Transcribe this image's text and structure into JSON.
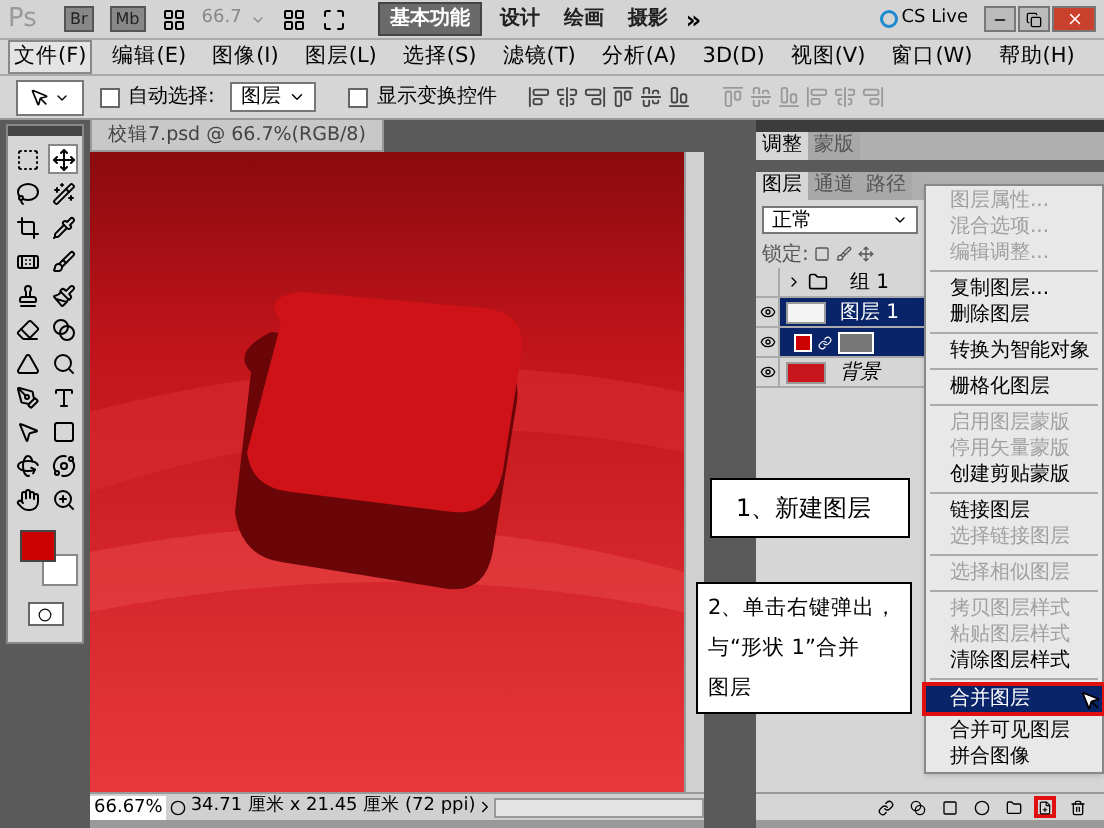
{
  "title_bar": {
    "logo": "Ps",
    "apps": [
      "Br",
      "Mb"
    ],
    "zoom": "66.7",
    "workspaces": [
      {
        "label": "基本功能",
        "selected": true
      },
      {
        "label": "设计",
        "selected": false
      },
      {
        "label": "绘画",
        "selected": false
      },
      {
        "label": "摄影",
        "selected": false
      }
    ],
    "more": "»",
    "cs_live": "CS Live"
  },
  "menu": [
    {
      "label": "文件(F)",
      "selected": true
    },
    {
      "label": "编辑(E)",
      "selected": false
    },
    {
      "label": "图像(I)",
      "selected": false
    },
    {
      "label": "图层(L)",
      "selected": false
    },
    {
      "label": "选择(S)",
      "selected": false
    },
    {
      "label": "滤镜(T)",
      "selected": false
    },
    {
      "label": "分析(A)",
      "selected": false
    },
    {
      "label": "3D(D)",
      "selected": false
    },
    {
      "label": "视图(V)",
      "selected": false
    },
    {
      "label": "窗口(W)",
      "selected": false
    },
    {
      "label": "帮助(H)",
      "selected": false
    }
  ],
  "options_bar": {
    "auto_select": {
      "label": "自动选择:",
      "checked": false
    },
    "auto_select_target": "图层",
    "show_transform": {
      "label": "显示变换控件",
      "checked": false
    }
  },
  "tools": [
    {
      "selected": false
    },
    {
      "selected": true
    },
    {
      "selected": false
    },
    {
      "selected": false
    },
    {
      "selected": false
    },
    {
      "selected": false
    },
    {
      "selected": false
    },
    {
      "selected": false
    },
    {
      "selected": false
    },
    {
      "selected": false
    },
    {
      "selected": false
    },
    {
      "selected": false
    },
    {
      "selected": false
    },
    {
      "selected": false
    },
    {
      "selected": false
    },
    {
      "selected": false
    },
    {
      "selected": false
    },
    {
      "selected": false
    },
    {
      "selected": false
    },
    {
      "selected": false
    },
    {
      "selected": false
    },
    {
      "selected": false
    }
  ],
  "document": {
    "tab": "校辑7.psd @ 66.7%(RGB/8)",
    "zoom": "66.67%",
    "size": "34.71 厘米 x 21.45 厘米 (72 ppi)"
  },
  "panels": {
    "top_tabs": [
      {
        "label": "调整",
        "selected": true
      },
      {
        "label": "蒙版",
        "selected": false
      }
    ],
    "layer_tabs": [
      {
        "label": "图层",
        "selected": true
      },
      {
        "label": "通道",
        "selected": false
      },
      {
        "label": "路径",
        "selected": false
      }
    ],
    "blend_mode": "正常",
    "lock_label": "锁定:",
    "layers": [
      {
        "kind": "group",
        "name": "组 1",
        "visible": false,
        "selected": false
      },
      {
        "kind": "layer",
        "name": "图层 1",
        "visible": true,
        "selected": true
      },
      {
        "kind": "shape",
        "visible": true,
        "selected": true
      },
      {
        "kind": "background",
        "name": "背景",
        "visible": true,
        "selected": false
      }
    ],
    "footer_buttons": [
      {
        "outlined": false
      },
      {
        "outlined": false
      },
      {
        "outlined": false
      },
      {
        "outlined": false
      },
      {
        "outlined": false
      },
      {
        "outlined": true
      },
      {
        "outlined": false
      }
    ]
  },
  "context_menu": {
    "items": [
      {
        "kind": "item",
        "label": "图层属性...",
        "disabled": true,
        "selected": false,
        "outlined": false
      },
      {
        "kind": "item",
        "label": "混合选项...",
        "disabled": true,
        "selected": false,
        "outlined": false
      },
      {
        "kind": "item",
        "label": "编辑调整...",
        "disabled": true,
        "selected": false,
        "outlined": false
      },
      {
        "kind": "separator"
      },
      {
        "kind": "item",
        "label": "复制图层...",
        "disabled": false,
        "selected": false,
        "outlined": false
      },
      {
        "kind": "item",
        "label": "删除图层",
        "disabled": false,
        "selected": false,
        "outlined": false
      },
      {
        "kind": "separator"
      },
      {
        "kind": "item",
        "label": "转换为智能对象",
        "disabled": false,
        "selected": false,
        "outlined": false
      },
      {
        "kind": "separator"
      },
      {
        "kind": "item",
        "label": "栅格化图层",
        "disabled": false,
        "selected": false,
        "outlined": false
      },
      {
        "kind": "separator"
      },
      {
        "kind": "item",
        "label": "启用图层蒙版",
        "disabled": true,
        "selected": false,
        "outlined": false
      },
      {
        "kind": "item",
        "label": "停用矢量蒙版",
        "disabled": true,
        "selected": false,
        "outlined": false
      },
      {
        "kind": "item",
        "label": "创建剪贴蒙版",
        "disabled": false,
        "selected": false,
        "outlined": false
      },
      {
        "kind": "separator"
      },
      {
        "kind": "item",
        "label": "链接图层",
        "disabled": false,
        "selected": false,
        "outlined": false
      },
      {
        "kind": "item",
        "label": "选择链接图层",
        "disabled": true,
        "selected": false,
        "outlined": false
      },
      {
        "kind": "separator"
      },
      {
        "kind": "item",
        "label": "选择相似图层",
        "disabled": true,
        "selected": false,
        "outlined": false
      },
      {
        "kind": "separator"
      },
      {
        "kind": "item",
        "label": "拷贝图层样式",
        "disabled": true,
        "selected": false,
        "outlined": false
      },
      {
        "kind": "item",
        "label": "粘贴图层样式",
        "disabled": true,
        "selected": false,
        "outlined": false
      },
      {
        "kind": "item",
        "label": "清除图层样式",
        "disabled": false,
        "selected": false,
        "outlined": false
      },
      {
        "kind": "separator"
      },
      {
        "kind": "item",
        "label": "合并图层",
        "disabled": false,
        "selected": true,
        "outlined": true
      },
      {
        "kind": "item",
        "label": "合并可见图层",
        "disabled": false,
        "selected": false,
        "outlined": false
      },
      {
        "kind": "item",
        "label": "拼合图像",
        "disabled": false,
        "selected": false,
        "outlined": false
      }
    ]
  },
  "callouts": [
    {
      "lines": [
        "1、新建图层"
      ]
    },
    {
      "lines": [
        "2、单击右键弹出，",
        "与“形状 1”合并",
        "图层"
      ]
    }
  ]
}
